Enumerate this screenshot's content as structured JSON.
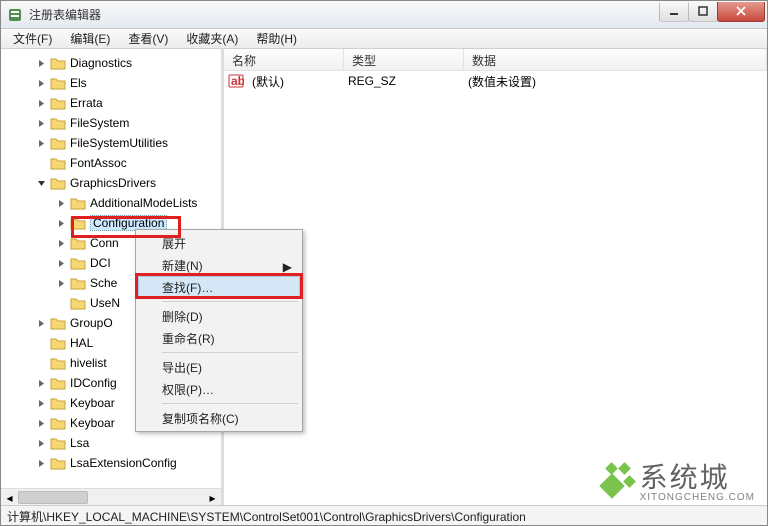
{
  "window": {
    "title": "注册表编辑器"
  },
  "menu": {
    "file": "文件(F)",
    "edit": "编辑(E)",
    "view": "查看(V)",
    "favorites": "收藏夹(A)",
    "help": "帮助(H)"
  },
  "tree": {
    "items": [
      {
        "indent": 36,
        "exp": "closed",
        "label": "Diagnostics"
      },
      {
        "indent": 36,
        "exp": "closed",
        "label": "Els"
      },
      {
        "indent": 36,
        "exp": "closed",
        "label": "Errata"
      },
      {
        "indent": 36,
        "exp": "closed",
        "label": "FileSystem"
      },
      {
        "indent": 36,
        "exp": "closed",
        "label": "FileSystemUtilities"
      },
      {
        "indent": 36,
        "exp": "none",
        "label": "FontAssoc"
      },
      {
        "indent": 36,
        "exp": "open",
        "label": "GraphicsDrivers"
      },
      {
        "indent": 56,
        "exp": "closed",
        "label": "AdditionalModeLists"
      },
      {
        "indent": 56,
        "exp": "closed",
        "label": "Configuration",
        "selected": true,
        "highlight": true
      },
      {
        "indent": 56,
        "exp": "closed",
        "label": "Conn"
      },
      {
        "indent": 56,
        "exp": "closed",
        "label": "DCI"
      },
      {
        "indent": 56,
        "exp": "closed",
        "label": "Sche"
      },
      {
        "indent": 56,
        "exp": "none",
        "label": "UseN"
      },
      {
        "indent": 36,
        "exp": "closed",
        "label": "GroupO"
      },
      {
        "indent": 36,
        "exp": "none",
        "label": "HAL"
      },
      {
        "indent": 36,
        "exp": "none",
        "label": "hivelist"
      },
      {
        "indent": 36,
        "exp": "closed",
        "label": "IDConfig"
      },
      {
        "indent": 36,
        "exp": "closed",
        "label": "Keyboar"
      },
      {
        "indent": 36,
        "exp": "closed",
        "label": "Keyboar"
      },
      {
        "indent": 36,
        "exp": "closed",
        "label": "Lsa"
      },
      {
        "indent": 36,
        "exp": "closed",
        "label": "LsaExtensionConfig"
      }
    ]
  },
  "list": {
    "columns": {
      "name": "名称",
      "type": "类型",
      "data": "数据"
    },
    "rows": [
      {
        "name": "(默认)",
        "type": "REG_SZ",
        "data": "(数值未设置)"
      }
    ]
  },
  "context_menu": {
    "expand": "展开",
    "new": "新建(N)",
    "find": "查找(F)…",
    "delete": "删除(D)",
    "rename": "重命名(R)",
    "export": "导出(E)",
    "permissions": "权限(P)…",
    "copy_key_name": "复制项名称(C)"
  },
  "status": {
    "path": "计算机\\HKEY_LOCAL_MACHINE\\SYSTEM\\ControlSet001\\Control\\GraphicsDrivers\\Configuration"
  },
  "branding": {
    "name": "系统城",
    "url": "XITONGCHENG.COM"
  }
}
